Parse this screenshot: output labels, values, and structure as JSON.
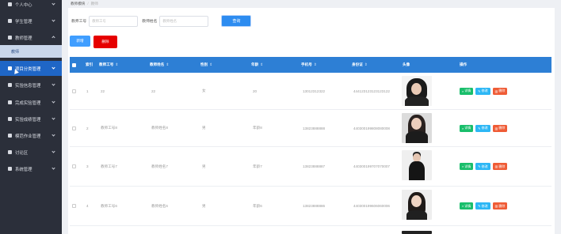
{
  "sidebar": {
    "items": [
      {
        "label": "个人中心"
      },
      {
        "label": "学生管理"
      },
      {
        "label": "教师管理"
      },
      {
        "label": "项目分类管理"
      },
      {
        "label": "实验信息管理"
      },
      {
        "label": "完成实验管理"
      },
      {
        "label": "实验成绩管理"
      },
      {
        "label": "模范作业管理"
      },
      {
        "label": "讨论区"
      },
      {
        "label": "系统管理"
      }
    ],
    "sub_item": "教师"
  },
  "breadcrumb": {
    "home": "教师模块",
    "current": "教师"
  },
  "search": {
    "label_id": "教师工号",
    "placeholder_id": "教师工号",
    "label_name": "教师姓名",
    "placeholder_name": "教师姓名",
    "button": "查询"
  },
  "actions": {
    "add": "新增",
    "delete": "删除"
  },
  "table": {
    "headers": {
      "index": "索引",
      "id": "教师工号",
      "name": "教师姓名",
      "gender": "性别",
      "age": "年龄",
      "phone": "手机号",
      "idcard": "身份证",
      "photo": "头像",
      "ops": "操作"
    },
    "sort_icon": "⇕",
    "op_labels": {
      "detail": "详情",
      "edit": "修改",
      "remove": "删除"
    },
    "rows": [
      {
        "index": "1",
        "id": "22",
        "name": "22",
        "gender": "女",
        "age": "20",
        "phone": "13012312322",
        "idcard": "444123123123123122"
      },
      {
        "index": "2",
        "id": "教师工号8",
        "name": "教师姓名8",
        "gender": "男",
        "age": "年龄8",
        "phone": "13823888888",
        "idcard": "440300199808080008"
      },
      {
        "index": "3",
        "id": "教师工号7",
        "name": "教师姓名7",
        "gender": "男",
        "age": "年龄7",
        "phone": "13823888887",
        "idcard": "440300199707070007"
      },
      {
        "index": "4",
        "id": "教师工号6",
        "name": "教师姓名6",
        "gender": "男",
        "age": "年龄6",
        "phone": "13823888886",
        "idcard": "440300199606060006"
      }
    ]
  },
  "colors": {
    "sidebar_bg": "#2b2f3a",
    "active": "#1f66c6",
    "table_header": "#2d7fd5",
    "add_button": "#409eff",
    "delete_button": "#e60000",
    "detail": "#19be6b",
    "edit": "#2db7f5",
    "remove": "#ed4014"
  }
}
